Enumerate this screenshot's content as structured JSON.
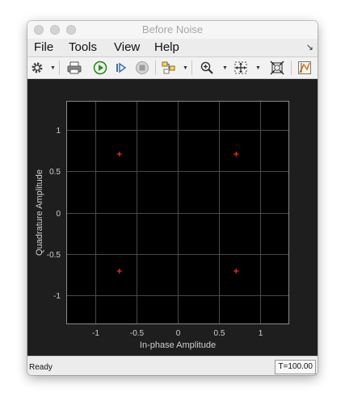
{
  "window": {
    "title": "Before Noise"
  },
  "menu": {
    "items": [
      "File",
      "Tools",
      "View",
      "Help"
    ],
    "corner_icon": "undock-arrow-icon"
  },
  "toolbar": {
    "buttons": [
      {
        "name": "settings-icon",
        "dropdown": true
      },
      {
        "name": "print-icon",
        "dropdown": false
      },
      {
        "name": "run-icon",
        "dropdown": false
      },
      {
        "name": "step-forward-icon",
        "dropdown": false
      },
      {
        "name": "stop-icon",
        "dropdown": false
      },
      {
        "name": "highlight-simulink-block-icon",
        "dropdown": true
      },
      {
        "name": "zoom-in-icon",
        "dropdown": true
      },
      {
        "name": "fit-to-view-icon",
        "dropdown": true
      },
      {
        "name": "autoscale-icon",
        "dropdown": false
      },
      {
        "name": "measurements-icon",
        "dropdown": false
      }
    ]
  },
  "status": {
    "text": "Ready",
    "time": "T=100.00"
  },
  "colors": {
    "figure_background": "#1e1e1e",
    "axes_background": "#000000",
    "grid": "#4a4a4a",
    "axis_text": "#cfcfcf",
    "marker": "#ff2a2a"
  },
  "chart_data": {
    "type": "scatter",
    "title": "",
    "xlabel": "In-phase Amplitude",
    "ylabel": "Quadrature Amplitude",
    "xlim": [
      -1.35,
      1.35
    ],
    "ylim": [
      -1.35,
      1.35
    ],
    "xticks": [
      -1,
      -0.5,
      0,
      0.5,
      1
    ],
    "yticks": [
      -1,
      -0.5,
      0,
      0.5,
      1
    ],
    "xtick_labels": [
      "-1",
      "-0.5",
      "0",
      "0.5",
      "1"
    ],
    "ytick_labels": [
      "-1",
      "-0.5",
      "0",
      "0.5",
      "1"
    ],
    "grid": true,
    "marker": "+",
    "points": [
      {
        "x": -0.707,
        "y": 0.707
      },
      {
        "x": 0.707,
        "y": 0.707
      },
      {
        "x": -0.707,
        "y": -0.707
      },
      {
        "x": 0.707,
        "y": -0.707
      }
    ]
  }
}
